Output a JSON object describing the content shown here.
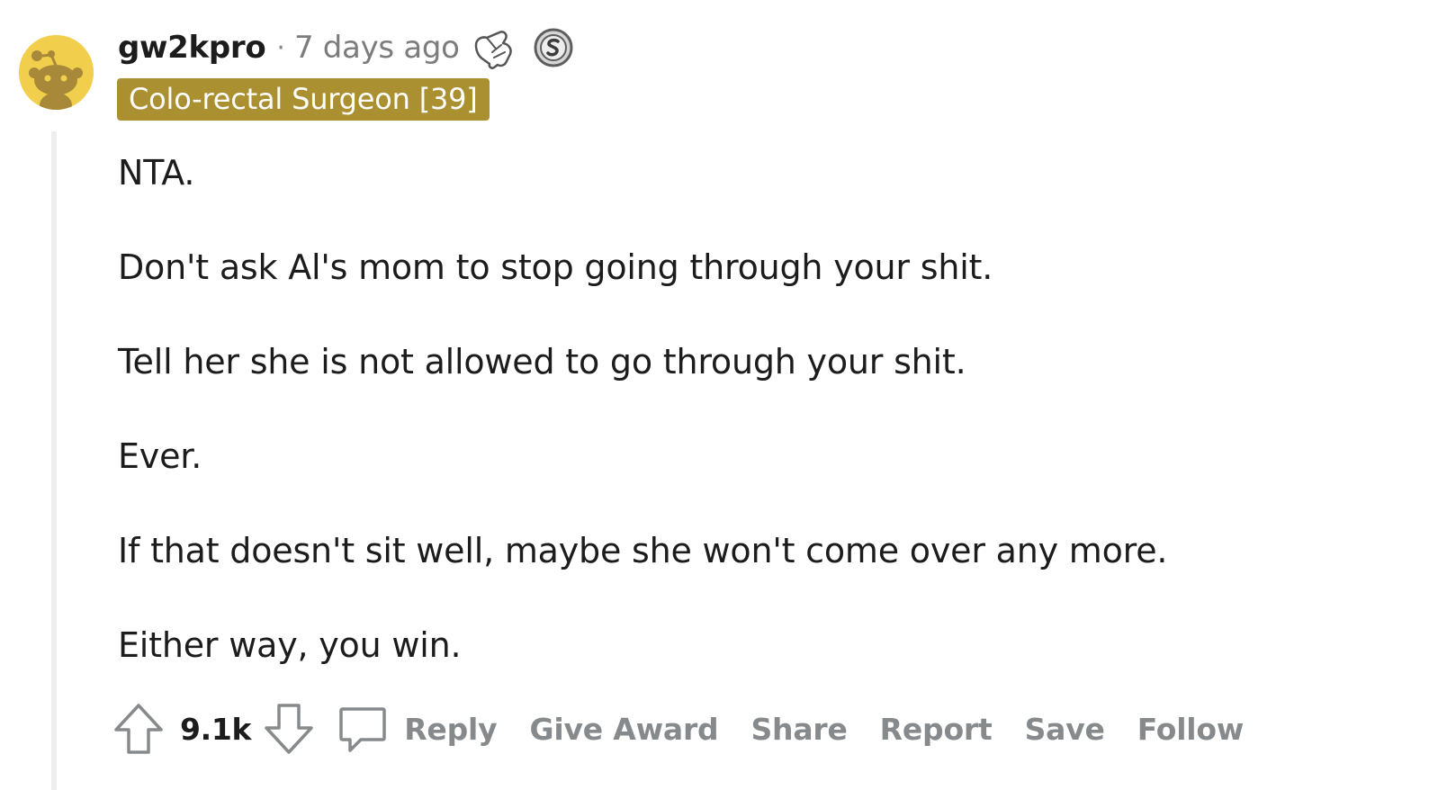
{
  "comment": {
    "author": "gw2kpro",
    "separator": "·",
    "timestamp": "7 days ago",
    "flair": "Colo-rectal Surgeon [39]",
    "awards": [
      "pointing-hand-icon",
      "silver-coin-icon"
    ],
    "avatar_color": "#f1cf4c",
    "flair_color": "#ab9032",
    "body": [
      "NTA.",
      "Don't ask Al's mom to stop going through your shit.",
      "Tell her she is not allowed to go through your shit.",
      "Ever.",
      "If that doesn't sit well, maybe she won't come over any more.",
      "Either way, you win."
    ],
    "score": "9.1k",
    "actions": {
      "reply": "Reply",
      "give_award": "Give Award",
      "share": "Share",
      "report": "Report",
      "save": "Save",
      "follow": "Follow"
    }
  }
}
